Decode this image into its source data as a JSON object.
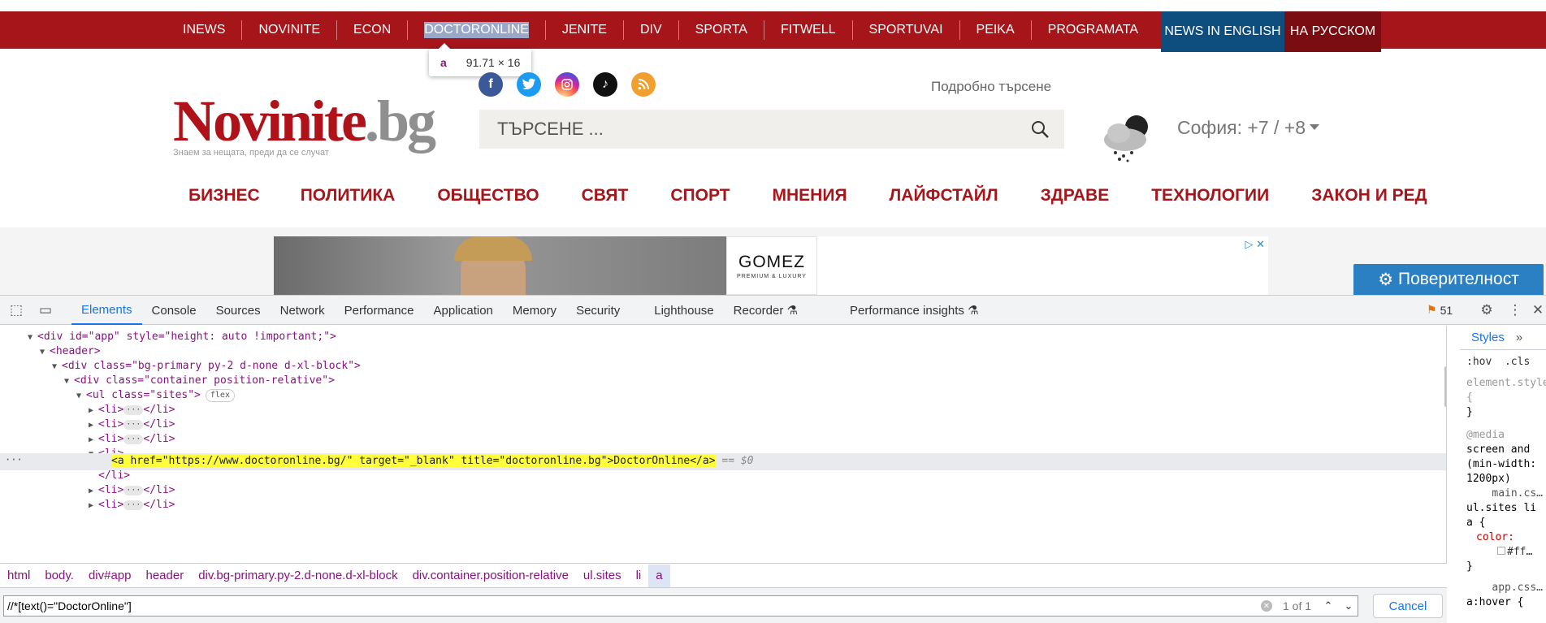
{
  "sites_bar": {
    "items": [
      "INEWS",
      "NOVINITE",
      "ECON",
      "DOCTORONLINE",
      "JENITE",
      "DIV",
      "SPORTA",
      "FITWELL",
      "SPORTUVAI",
      "PEIKA",
      "PROGRAMATA"
    ],
    "news_english": "NEWS IN ENGLISH",
    "na_russkom": "НА РУССКОМ",
    "colors": {
      "bar": "#a6151a",
      "english": "#0e4e7f",
      "russian": "#7a0d11"
    }
  },
  "inspect_tooltip": {
    "tag": "a",
    "dimensions": "91.71 × 16"
  },
  "logo": {
    "part1": "Novinite",
    "part2": ".bg",
    "tagline": "Знаем за нещата, преди да се случат"
  },
  "social": [
    "facebook-icon",
    "twitter-icon",
    "instagram-icon",
    "tiktok-icon",
    "rss-icon"
  ],
  "search": {
    "advanced_link": "Подробно търсене",
    "placeholder": "ТЪРСЕНЕ ..."
  },
  "weather": {
    "text": "София: +7 / +8"
  },
  "main_nav": [
    "БИЗНЕС",
    "ПОЛИТИКА",
    "ОБЩЕСТВО",
    "СВЯТ",
    "СПОРТ",
    "МНЕНИЯ",
    "ЛАЙФСТАЙЛ",
    "ЗДРАВЕ",
    "ТЕХНОЛОГИИ",
    "ЗАКОН И РЕД"
  ],
  "ad": {
    "brand": "GOMEZ",
    "subline": "PREMIUM & LUXURY"
  },
  "privacy_button": "Поверителност",
  "devtools": {
    "tabs": [
      "Elements",
      "Console",
      "Sources",
      "Network",
      "Performance",
      "Application",
      "Memory",
      "Security",
      "Lighthouse",
      "Recorder",
      "Performance insights"
    ],
    "active_tab": "Elements",
    "issues_count": "51",
    "dom": {
      "app_div": "<div id=\"app\" style=\"height: auto !important;\">",
      "header": "<header>",
      "div_primary": "<div class=\"bg-primary py-2 d-none d-xl-block\">",
      "div_container": "<div class=\"container position-relative\">",
      "ul_sites": "<ul class=\"sites\">",
      "flex_badge": "flex",
      "li_open": "<li>",
      "li_close": "</li>",
      "li_collapsed_open": "<li>",
      "li_collapsed_close": "</li>",
      "anchor": "<a href=\"https://www.doctoronline.bg/\" target=\"_blank\" title=\"doctoronline.bg\">DoctorOnline</a>",
      "dollar0": "== $0"
    },
    "styles": {
      "tab": "Styles",
      "hov": ":hov",
      "cls": ".cls",
      "element_style": "element.style {",
      "close_brace": "}",
      "media": "@media",
      "media_q1": "screen and",
      "media_q2": "(min-width:",
      "media_q3": "1200px)",
      "file1": "main.cs…",
      "selector1": "ul.sites li",
      "selector1b": "a {",
      "prop": "color:",
      "propval": "#ff…",
      "close_brace2": "}",
      "file2": "app.css…",
      "selector2": "a:hover {"
    },
    "breadcrumbs": [
      "html",
      "body.",
      "div#app",
      "header",
      "div.bg-primary.py-2.d-none.d-xl-block",
      "div.container.position-relative",
      "ul.sites",
      "li",
      "a"
    ],
    "search": {
      "query": "//*[text()=\"DoctorOnline\"]",
      "count": "1 of 1",
      "cancel": "Cancel"
    }
  }
}
